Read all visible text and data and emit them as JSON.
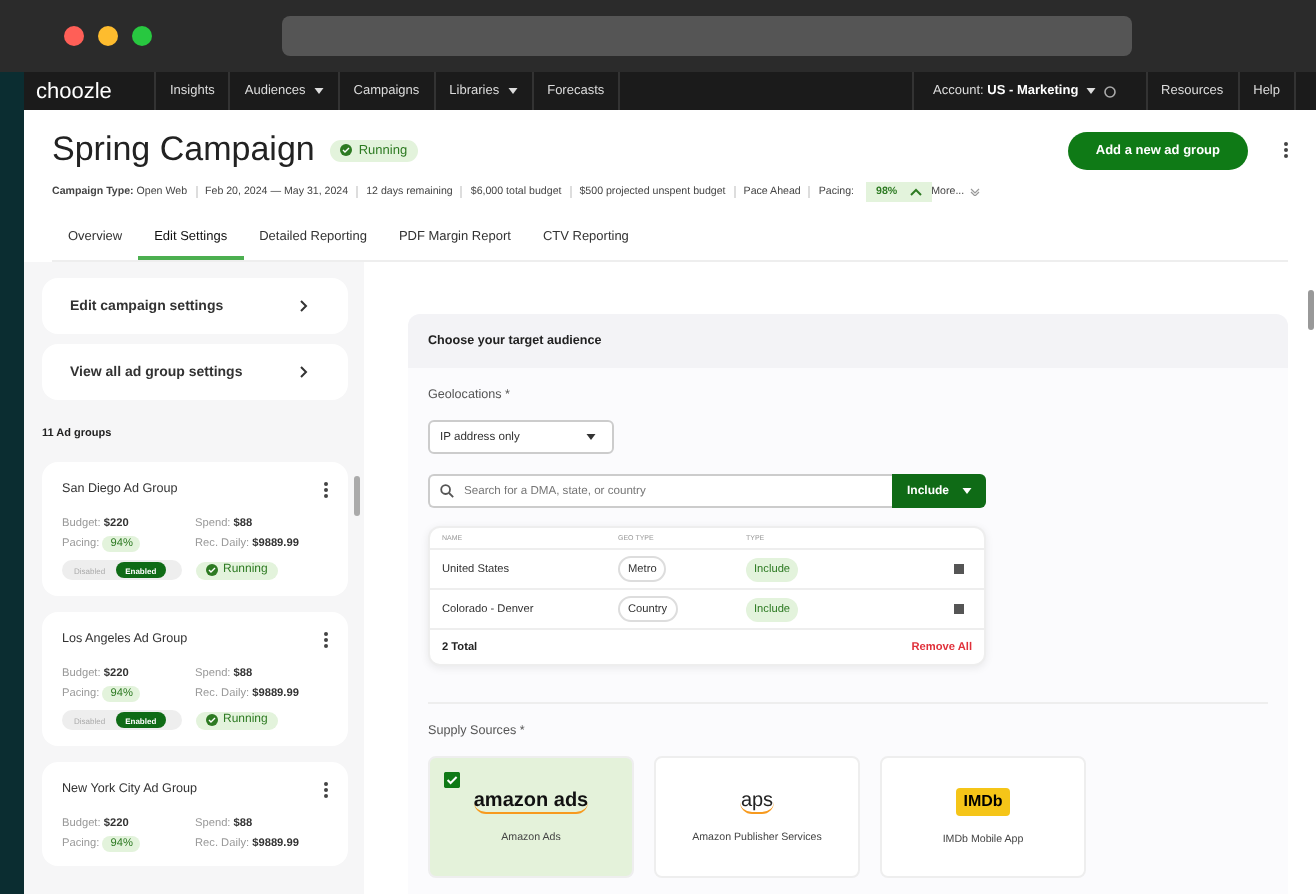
{
  "nav": {
    "logo": "choozle",
    "items": [
      {
        "label": "Insights",
        "dropdown": false
      },
      {
        "label": "Audiences",
        "dropdown": true
      },
      {
        "label": "Campaigns",
        "dropdown": false
      },
      {
        "label": "Libraries",
        "dropdown": true
      },
      {
        "label": "Forecasts",
        "dropdown": false
      }
    ],
    "account_label": "Account:",
    "account_value": "US - Marketing",
    "right_items": [
      "Resources",
      "Help"
    ]
  },
  "header": {
    "title": "Spring Campaign",
    "status": "Running",
    "add_button": "Add a new ad group",
    "meta": [
      "**Campaign Type:** Open Web",
      "Feb 20, 2024 — May 31, 2024",
      "12 days remaining",
      "$6,000 total budget",
      "$500 projected unspent budget",
      "Pace Ahead"
    ],
    "pacing_label": "Pacing:",
    "pacing_value": "98%",
    "more": "More..."
  },
  "tabs": [
    {
      "label": "Overview",
      "selected": false
    },
    {
      "label": "Edit Settings",
      "selected": true
    },
    {
      "label": "Detailed Reporting",
      "selected": false
    },
    {
      "label": "PDF Margin Report",
      "selected": false
    },
    {
      "label": "CTV Reporting",
      "selected": false
    }
  ],
  "sidebar": {
    "links": [
      "Edit campaign settings",
      "View all ad group settings"
    ],
    "count": "11 Ad groups",
    "ad_groups": [
      {
        "name": "San Diego Ad Group",
        "stats": [
          {
            "label": "Budget:",
            "value": "$220"
          },
          {
            "label": "Spend:",
            "value": "$88"
          },
          {
            "label": "Pacing:",
            "value": "94%",
            "kind": "badge"
          },
          {
            "label": "Rec. Daily:",
            "value": "$9889.99"
          }
        ],
        "toggle": [
          {
            "label": "Disabled",
            "selected": false
          },
          {
            "label": "Enabled",
            "selected": true
          }
        ],
        "status": "Running"
      },
      {
        "name": "Los Angeles Ad Group",
        "stats": [
          {
            "label": "Budget:",
            "value": "$220"
          },
          {
            "label": "Spend:",
            "value": "$88"
          },
          {
            "label": "Pacing:",
            "value": "94%",
            "kind": "badge"
          },
          {
            "label": "Rec. Daily:",
            "value": "$9889.99"
          }
        ],
        "toggle": [
          {
            "label": "Disabled",
            "selected": false
          },
          {
            "label": "Enabled",
            "selected": true
          }
        ],
        "status": "Running"
      },
      {
        "name": "New York City Ad Group",
        "stats": [
          {
            "label": "Budget:",
            "value": "$220"
          },
          {
            "label": "Spend:",
            "value": "$88"
          },
          {
            "label": "Pacing:",
            "value": "94%",
            "kind": "badge"
          },
          {
            "label": "Rec. Daily:",
            "value": "$9889.99"
          }
        ]
      }
    ]
  },
  "audience": {
    "title": "Choose your target audience",
    "geo_label": "Geolocations *",
    "select": "IP address only",
    "search_placeholder": "Search for a DMA, state, or country",
    "include_button": "Include",
    "columns": [
      "NAME",
      "GEO TYPE",
      "TYPE"
    ],
    "rows": [
      {
        "name": "United States",
        "geo_type": "Metro",
        "type": "Include"
      },
      {
        "name": "Colorado - Denver",
        "geo_type": "Country",
        "type": "Include"
      }
    ],
    "total": "2 Total",
    "remove_all": "Remove All",
    "supply_label": "Supply Sources *",
    "sources": [
      {
        "kind": "amazon-ads",
        "logo_text": "amazon ads",
        "label": "Amazon Ads",
        "selected": true
      },
      {
        "kind": "aps",
        "logo_text": "aps",
        "label": "Amazon Publisher Services",
        "selected": false
      },
      {
        "kind": "imdb",
        "logo_text": "IMDb",
        "label": "IMDb Mobile App",
        "selected": false
      }
    ]
  }
}
